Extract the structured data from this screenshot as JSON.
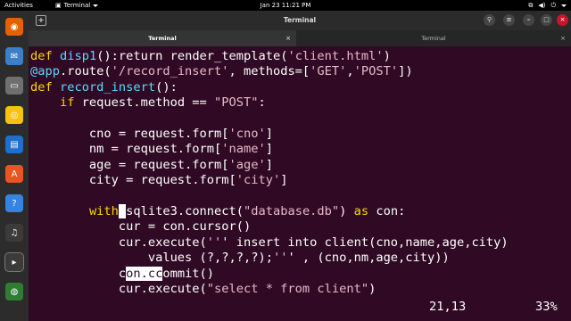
{
  "topbar": {
    "activities": "Activities",
    "app": "Terminal",
    "clock": "Jan 23  11:21 PM"
  },
  "dock": {
    "icons": [
      "firefox-icon",
      "thunderbird-icon",
      "files-icon",
      "rhythmbox-icon",
      "libreoffice-writer-icon",
      "software-icon",
      "help-icon",
      "music-icon",
      "terminal-icon",
      "dvd-icon"
    ],
    "colors": [
      "#e66000",
      "#3d7ec9",
      "#6f6f6f",
      "#f5c211",
      "#1f6fce",
      "#e95420",
      "#3584e4",
      "#3b3b3b",
      "#3b3b3b",
      "#2e7d32"
    ]
  },
  "window": {
    "title": "Terminal",
    "tabs": [
      {
        "label": "Terminal"
      },
      {
        "label": "Terminal"
      }
    ]
  },
  "editor": {
    "lines": [
      "def disp1():return render_template('client.html')",
      "@app.route('/record_insert', methods=['GET','POST'])",
      "def record_insert():",
      "    if request.method == \"POST\":",
      "",
      "        cno = request.form['cno']",
      "        nm = request.form['name']",
      "        age = request.form['age']",
      "        city = request.form['city']",
      "",
      "        with sqlite3.connect(\"database.db\") as con:",
      "            cur = con.cursor()",
      "            cur.execute(''' insert into client(cno,name,age,city)",
      "                values (?,?,?,?);''' , (cno,nm,age,city))",
      "            con.commit()",
      "            cur.execute(\"select * from client\")"
    ],
    "position": "21,13",
    "percent": "33%"
  }
}
